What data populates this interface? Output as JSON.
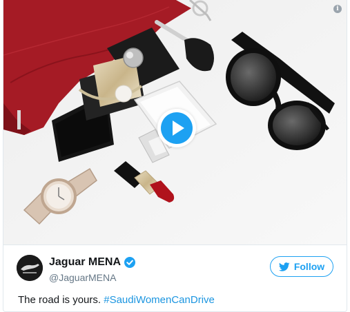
{
  "account": {
    "display_name": "Jaguar MENA",
    "handle": "@JaguarMENA",
    "avatar_icon": "jaguar-logo",
    "verified": true
  },
  "follow_button": {
    "label": "Follow",
    "icon": "twitter-bird-icon"
  },
  "tweet": {
    "text": "The road is yours.",
    "hashtag": "#SaudiWomenCanDrive"
  },
  "media": {
    "type": "video",
    "play_icon": "play-icon",
    "info_icon": "info-icon"
  },
  "colors": {
    "accent": "#1da1f2",
    "link": "#1b95e0",
    "text": "#14171a",
    "muted": "#657786",
    "bag": "#a51b25"
  }
}
